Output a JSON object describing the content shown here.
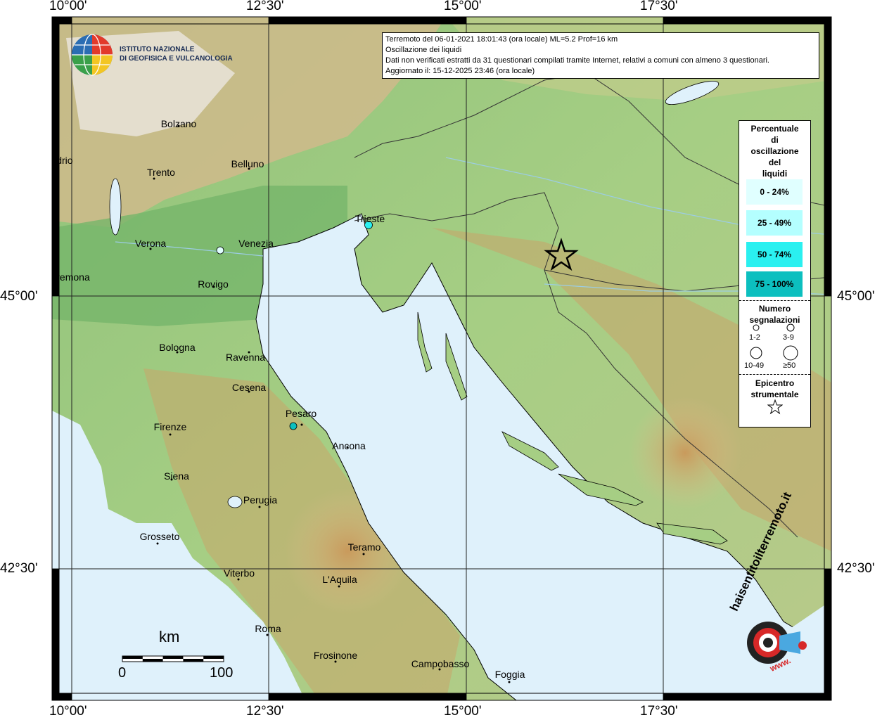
{
  "axes": {
    "top_lon": [
      "10°00'",
      "12°30'",
      "15°00'",
      "17°30'"
    ],
    "bottom_lon": [
      "10°00'",
      "12°30'",
      "15°00'",
      "17°30'"
    ],
    "left_lat": [
      "45°00'",
      "42°30'"
    ],
    "right_lat": [
      "45°00'",
      "42°30'"
    ]
  },
  "info": {
    "line1": "Terremoto del 06-01-2021 18:01:43 (ora locale) ML=5.2 Prof=16 km",
    "line2": "Oscillazione dei liquidi",
    "line3": "Dati non verificati estratti da 31 questionari compilati tramite Internet, relativi a comuni con almeno 3 questionari.",
    "line4": "Aggiornato il: 15-12-2025 23:46 (ora locale)"
  },
  "ingv": {
    "line1": "ISTITUTO NAZIONALE",
    "line2": "DI GEOFISICA E VULCANOLOGIA"
  },
  "cities": {
    "bolzano": "Bolzano",
    "sondrio": "ndrio",
    "trento": "Trento",
    "belluno": "Belluno",
    "trieste": "Trieste",
    "verona": "Verona",
    "venezia": "Venezia",
    "cremona": "remona",
    "rovigo": "Rovigo",
    "bologna": "Bologna",
    "ravenna": "Ravenna",
    "cesena": "Cesena",
    "pesaro": "Pesaro",
    "firenze": "Firenze",
    "ancona": "Ancona",
    "siena": "Siena",
    "perugia": "Perugia",
    "grosseto": "Grosseto",
    "teramo": "Teramo",
    "viterbo": "Viterbo",
    "laquila": "L'Aquila",
    "roma": "Roma",
    "frosinone": "Frosinone",
    "campobasso": "Campobasso",
    "foggia": "Foggia"
  },
  "legend": {
    "title": [
      "Percentuale",
      "di",
      "oscillazione",
      "del",
      "liquidi"
    ],
    "ranges": [
      {
        "label": "0 - 24%",
        "color": "#e0ffff"
      },
      {
        "label": "25 - 49%",
        "color": "#b4ffff"
      },
      {
        "label": "50 - 74%",
        "color": "#2af0f0"
      },
      {
        "label": "75 - 100%",
        "color": "#0cbfbf"
      }
    ],
    "count_title": [
      "Numero",
      "segnalazioni"
    ],
    "counts": [
      "1-2",
      "3-9",
      "10-49",
      "≥50"
    ],
    "epi_title": [
      "Epicentro",
      "strumentale"
    ]
  },
  "scale": {
    "unit": "km",
    "zero": "0",
    "max": "100"
  },
  "hsit": {
    "text": "haisentitoilterremoto.it",
    "www": "www."
  },
  "reports": [
    {
      "place": "Venezia area",
      "class": "0 - 24%"
    },
    {
      "place": "Trieste",
      "class": "50 - 74%"
    },
    {
      "place": "Pesaro area",
      "class": "75 - 100%"
    }
  ]
}
